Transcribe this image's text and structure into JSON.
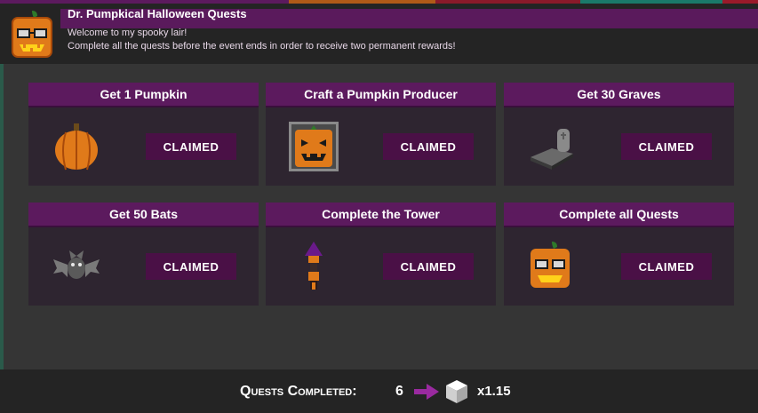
{
  "header": {
    "title": "Dr. Pumpkical Halloween Quests",
    "line1": "Welcome to my spooky lair!",
    "line2": "Complete all the quests before the event ends in order to receive two permanent rewards!"
  },
  "quests": [
    {
      "title": "Get 1 Pumpkin",
      "button": "CLAIMED",
      "icon": "pumpkin-icon"
    },
    {
      "title": "Craft a Pumpkin Producer",
      "button": "CLAIMED",
      "icon": "pumpkin-producer-icon"
    },
    {
      "title": "Get 30 Graves",
      "button": "CLAIMED",
      "icon": "grave-icon"
    },
    {
      "title": "Get 50 Bats",
      "button": "CLAIMED",
      "icon": "bat-icon"
    },
    {
      "title": "Complete the Tower",
      "button": "CLAIMED",
      "icon": "tower-icon"
    },
    {
      "title": "Complete all Quests",
      "button": "CLAIMED",
      "icon": "pumpkin-head-icon"
    }
  ],
  "footer": {
    "label": "Quests Completed:",
    "count": "6",
    "multiplier": "x1.15"
  },
  "colors": {
    "accent_purple": "#5c1a5e",
    "button_purple": "#4a1046",
    "arrow_purple": "#9a2aa0"
  }
}
